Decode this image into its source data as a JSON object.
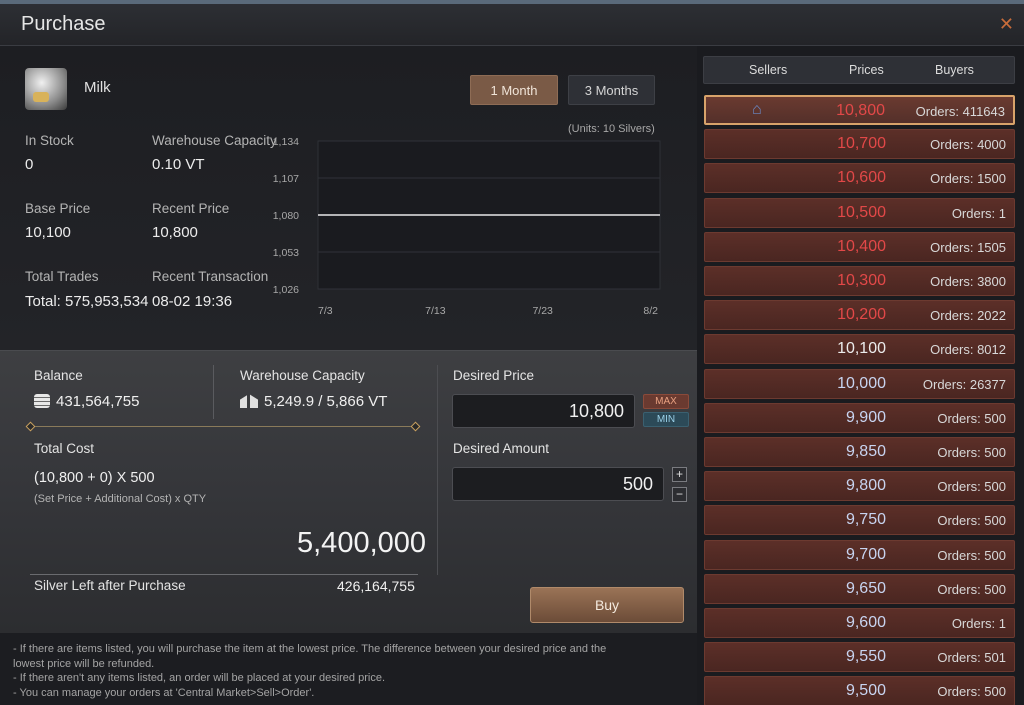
{
  "window": {
    "title": "Purchase",
    "close_icon": "close-icon"
  },
  "item": {
    "name": "Milk",
    "icon": "milk-bottle-icon"
  },
  "range": {
    "one_month": "1 Month",
    "three_months": "3 Months",
    "selected": "1 Month"
  },
  "stats": {
    "in_stock_label": "In Stock",
    "in_stock_value": "0",
    "warehouse_capacity_label": "Warehouse Capacity",
    "warehouse_capacity_value": "0.10 VT",
    "base_price_label": "Base Price",
    "base_price_value": "10,100",
    "recent_price_label": "Recent Price",
    "recent_price_value": "10,800",
    "total_trades_label": "Total Trades",
    "total_trades_value": "Total: 575,953,534",
    "recent_transaction_label": "Recent Transaction",
    "recent_transaction_value": "08-02 19:36"
  },
  "chart_data": {
    "type": "line",
    "units_label": "(Units: 10 Silvers)",
    "x_ticks": [
      "7/3",
      "7/13",
      "7/23",
      "8/2"
    ],
    "y_ticks": [
      "1,134",
      "1,107",
      "1,080",
      "1,053",
      "1,026"
    ],
    "ylim": [
      1026,
      1134
    ],
    "series": [
      {
        "values": [
          1080,
          1080,
          1080,
          1080
        ]
      }
    ],
    "grid": true,
    "line_color": "#e8e8e8"
  },
  "purchase": {
    "balance_label": "Balance",
    "balance_value": "431,564,755",
    "warehouse_capacity_label": "Warehouse Capacity",
    "warehouse_capacity_value": "5,249.9 / 5,866 VT",
    "total_cost_label": "Total Cost",
    "total_cost_formula": "(10,800 + 0) X 500",
    "total_cost_hint": "(Set Price + Additional Cost) x QTY",
    "total_cost_value": "5,400,000",
    "silver_left_label": "Silver Left after Purchase",
    "silver_left_value": "426,164,755",
    "desired_price_label": "Desired Price",
    "desired_price_value": "10,800",
    "max_label": "MAX",
    "min_label": "MIN",
    "desired_amount_label": "Desired Amount",
    "desired_amount_value": "500",
    "plus_label": "+",
    "minus_label": "−",
    "buy_label": "Buy"
  },
  "notes": [
    "- If there are items listed, you will purchase the item at the lowest price. The difference between your desired price and the",
    "lowest price will be refunded.",
    "- If there aren't any items listed, an order will be placed at your desired price.",
    "- You can manage your orders at 'Central Market>Sell>Order'."
  ],
  "orderbook": {
    "headers": {
      "sellers": "Sellers",
      "prices": "Prices",
      "buyers": "Buyers"
    },
    "rows": [
      {
        "price": "10,800",
        "orders": "Orders: 411643",
        "color": "red",
        "selected": true,
        "seller_icon": true
      },
      {
        "price": "10,700",
        "orders": "Orders: 4000",
        "color": "red"
      },
      {
        "price": "10,600",
        "orders": "Orders: 1500",
        "color": "red"
      },
      {
        "price": "10,500",
        "orders": "Orders: 1",
        "color": "red"
      },
      {
        "price": "10,400",
        "orders": "Orders: 1505",
        "color": "red"
      },
      {
        "price": "10,300",
        "orders": "Orders: 3800",
        "color": "red"
      },
      {
        "price": "10,200",
        "orders": "Orders: 2022",
        "color": "red"
      },
      {
        "price": "10,100",
        "orders": "Orders: 8012",
        "color": "white"
      },
      {
        "price": "10,000",
        "orders": "Orders: 26377",
        "color": "blue"
      },
      {
        "price": "9,900",
        "orders": "Orders: 500",
        "color": "blue"
      },
      {
        "price": "9,850",
        "orders": "Orders: 500",
        "color": "blue"
      },
      {
        "price": "9,800",
        "orders": "Orders: 500",
        "color": "blue"
      },
      {
        "price": "9,750",
        "orders": "Orders: 500",
        "color": "blue"
      },
      {
        "price": "9,700",
        "orders": "Orders: 500",
        "color": "blue"
      },
      {
        "price": "9,650",
        "orders": "Orders: 500",
        "color": "blue"
      },
      {
        "price": "9,600",
        "orders": "Orders: 1",
        "color": "blue"
      },
      {
        "price": "9,550",
        "orders": "Orders: 501",
        "color": "blue"
      },
      {
        "price": "9,500",
        "orders": "Orders: 500",
        "color": "blue"
      }
    ]
  }
}
